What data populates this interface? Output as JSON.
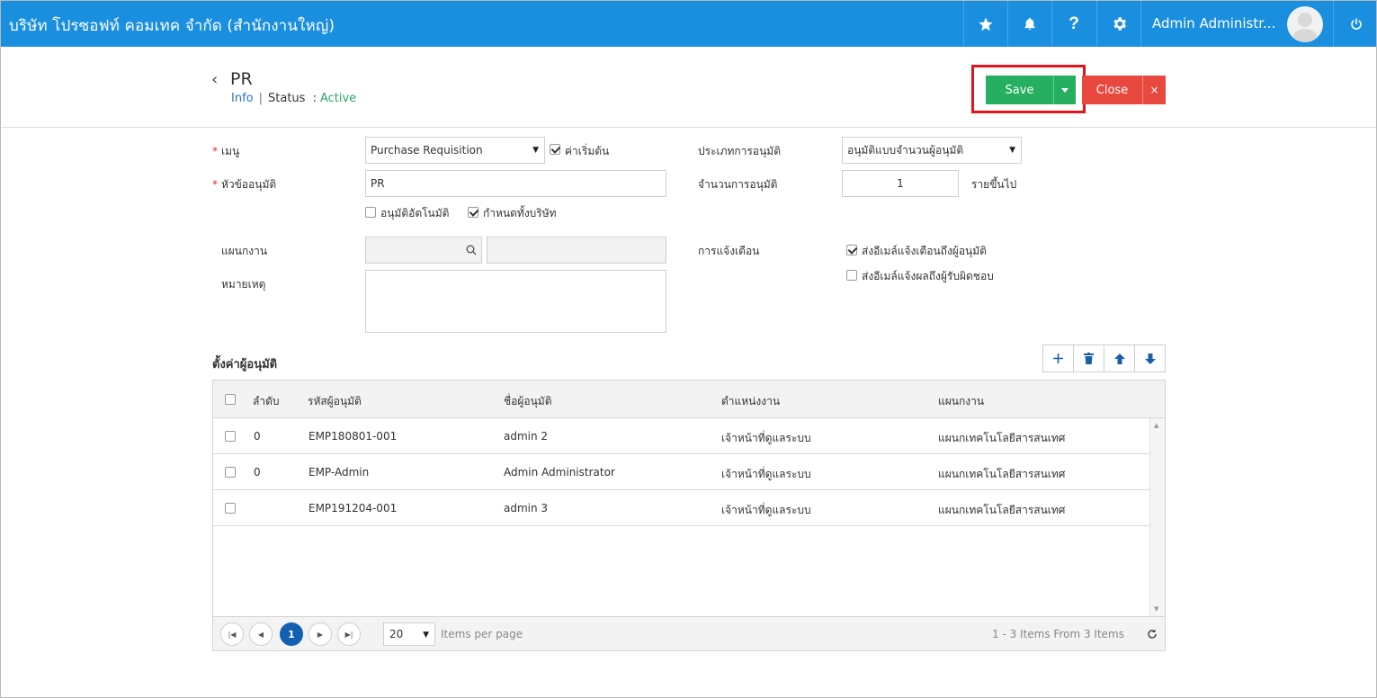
{
  "topbar": {
    "company": "บริษัท โปรซอฟท์ คอมเทค จำกัด (สำนักงานใหญ่)",
    "user_name": "Admin Administr...",
    "icons": [
      "star-icon",
      "bell-icon",
      "help-icon",
      "gear-icon",
      "power-icon"
    ]
  },
  "header": {
    "title": "PR",
    "info_link": "Info",
    "separator": "|",
    "status_label": "Status",
    "status_colon": ":",
    "status_value": "Active",
    "save_label": "Save",
    "close_label": "Close",
    "close_x": "×"
  },
  "form": {
    "menu_label": "เมนู",
    "menu_value": "Purchase Requisition",
    "default_label": "ค่าเริ่มต้น",
    "subject_label": "หัวข้ออนุมัติ",
    "subject_value": "PR",
    "auto_approve_label": "อนุมัติอัตโนมัติ",
    "company_wide_label": "กำหนดทั้งบริษัท",
    "department_label": "แผนกงาน",
    "remark_label": "หมายเหตุ",
    "approve_type_label": "ประเภทการอนุมัติ",
    "approve_type_value": "อนุมัติแบบจำนวนผู้อนุมัติ",
    "approve_count_label": "จำนวนการอนุมัติ",
    "approve_count_value": "1",
    "approve_count_unit": "รายขึ้นไป",
    "notify_label": "การแจ้งเตือน",
    "notify_email_approver": "ส่งอีเมล์แจ้งเตือนถึงผู้อนุมัติ",
    "notify_email_owner": "ส่งอีเมล์แจ้งผลถึงผู้รับผิดชอบ",
    "required_mark": "*"
  },
  "approvers": {
    "title": "ตั้งค่าผู้อนุมัติ",
    "columns": [
      "ลำดับ",
      "รหัสผู้อนุมัติ",
      "ชื่อผู้อนุมัติ",
      "ตำแหน่งงาน",
      "แผนกงาน"
    ],
    "rows": [
      {
        "order": "0",
        "code": "EMP180801-001",
        "name": "admin 2",
        "position": "เจ้าหน้าที่ดูแลระบบ",
        "department": "แผนกเทคโนโลยีสารสนเทศ"
      },
      {
        "order": "0",
        "code": "EMP-Admin",
        "name": "Admin Administrator",
        "position": "เจ้าหน้าที่ดูแลระบบ",
        "department": "แผนกเทคโนโลยีสารสนเทศ"
      },
      {
        "order": "",
        "code": "EMP191204-001",
        "name": "admin 3",
        "position": "เจ้าหน้าที่ดูแลระบบ",
        "department": "แผนกเทคโนโลยีสารสนเทศ"
      }
    ],
    "pager": {
      "current_page": "1",
      "page_size": "20",
      "items_per_page": "Items per page",
      "summary": "1 - 3 Items From 3 Items"
    }
  },
  "colors": {
    "topbar": "#1a8fe0",
    "save": "#26ae61",
    "close": "#e9483f",
    "highlight": "#e3141c",
    "active": "#2ea56b",
    "page_current": "#1360b0"
  }
}
